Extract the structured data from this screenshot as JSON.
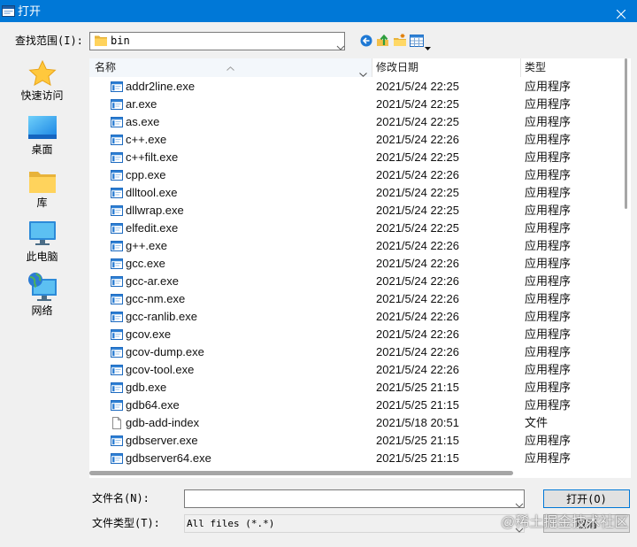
{
  "window": {
    "title": "打开",
    "app_icon": "dialog-app-icon",
    "close_icon": "close-icon"
  },
  "look_in": {
    "label": "查找范围(I):",
    "value": "bin",
    "value_icon": "folder-icon"
  },
  "toolbar": {
    "icons": [
      "back-icon",
      "up-one-level-icon",
      "new-folder-icon",
      "view-menu-icon"
    ]
  },
  "places": [
    {
      "label": "快速访问",
      "icon": "star-icon"
    },
    {
      "label": "桌面",
      "icon": "desktop-icon"
    },
    {
      "label": "库",
      "icon": "library-folder-icon"
    },
    {
      "label": "此电脑",
      "icon": "computer-icon"
    },
    {
      "label": "网络",
      "icon": "network-icon"
    }
  ],
  "file_list": {
    "columns": [
      "名称",
      "修改日期",
      "类型"
    ],
    "header_icons": {
      "sort": "sort-ascending-icon",
      "column_menu": "chevron-down-icon"
    },
    "rows": [
      {
        "name": "addr2line.exe",
        "modified": "2021/5/24 22:25",
        "type": "应用程序",
        "icon": "exe-icon"
      },
      {
        "name": "ar.exe",
        "modified": "2021/5/24 22:25",
        "type": "应用程序",
        "icon": "exe-icon"
      },
      {
        "name": "as.exe",
        "modified": "2021/5/24 22:25",
        "type": "应用程序",
        "icon": "exe-icon"
      },
      {
        "name": "c++.exe",
        "modified": "2021/5/24 22:26",
        "type": "应用程序",
        "icon": "exe-icon"
      },
      {
        "name": "c++filt.exe",
        "modified": "2021/5/24 22:25",
        "type": "应用程序",
        "icon": "exe-icon"
      },
      {
        "name": "cpp.exe",
        "modified": "2021/5/24 22:26",
        "type": "应用程序",
        "icon": "exe-icon"
      },
      {
        "name": "dlltool.exe",
        "modified": "2021/5/24 22:25",
        "type": "应用程序",
        "icon": "exe-icon"
      },
      {
        "name": "dllwrap.exe",
        "modified": "2021/5/24 22:25",
        "type": "应用程序",
        "icon": "exe-icon"
      },
      {
        "name": "elfedit.exe",
        "modified": "2021/5/24 22:25",
        "type": "应用程序",
        "icon": "exe-icon"
      },
      {
        "name": "g++.exe",
        "modified": "2021/5/24 22:26",
        "type": "应用程序",
        "icon": "exe-icon"
      },
      {
        "name": "gcc.exe",
        "modified": "2021/5/24 22:26",
        "type": "应用程序",
        "icon": "exe-icon"
      },
      {
        "name": "gcc-ar.exe",
        "modified": "2021/5/24 22:26",
        "type": "应用程序",
        "icon": "exe-icon"
      },
      {
        "name": "gcc-nm.exe",
        "modified": "2021/5/24 22:26",
        "type": "应用程序",
        "icon": "exe-icon"
      },
      {
        "name": "gcc-ranlib.exe",
        "modified": "2021/5/24 22:26",
        "type": "应用程序",
        "icon": "exe-icon"
      },
      {
        "name": "gcov.exe",
        "modified": "2021/5/24 22:26",
        "type": "应用程序",
        "icon": "exe-icon"
      },
      {
        "name": "gcov-dump.exe",
        "modified": "2021/5/24 22:26",
        "type": "应用程序",
        "icon": "exe-icon"
      },
      {
        "name": "gcov-tool.exe",
        "modified": "2021/5/24 22:26",
        "type": "应用程序",
        "icon": "exe-icon"
      },
      {
        "name": "gdb.exe",
        "modified": "2021/5/25 21:15",
        "type": "应用程序",
        "icon": "exe-icon"
      },
      {
        "name": "gdb64.exe",
        "modified": "2021/5/25 21:15",
        "type": "应用程序",
        "icon": "exe-icon"
      },
      {
        "name": "gdb-add-index",
        "modified": "2021/5/18 20:51",
        "type": "文件",
        "icon": "file-icon"
      },
      {
        "name": "gdbserver.exe",
        "modified": "2021/5/25 21:15",
        "type": "应用程序",
        "icon": "exe-icon"
      },
      {
        "name": "gdbserver64.exe",
        "modified": "2021/5/25 21:15",
        "type": "应用程序",
        "icon": "exe-icon"
      }
    ]
  },
  "file_name": {
    "label": "文件名(N):",
    "value": ""
  },
  "file_type": {
    "label": "文件类型(T):",
    "value": "All files (*.*)"
  },
  "buttons": {
    "open": "打开(O)",
    "cancel": "取消"
  },
  "watermark": "@稀土掘金技术社区",
  "colors": {
    "title_bar": "#0078D7",
    "default_button_border": "#0078D7",
    "list_background": "#FFFFFF",
    "dialog_background": "#F0F0F0"
  }
}
